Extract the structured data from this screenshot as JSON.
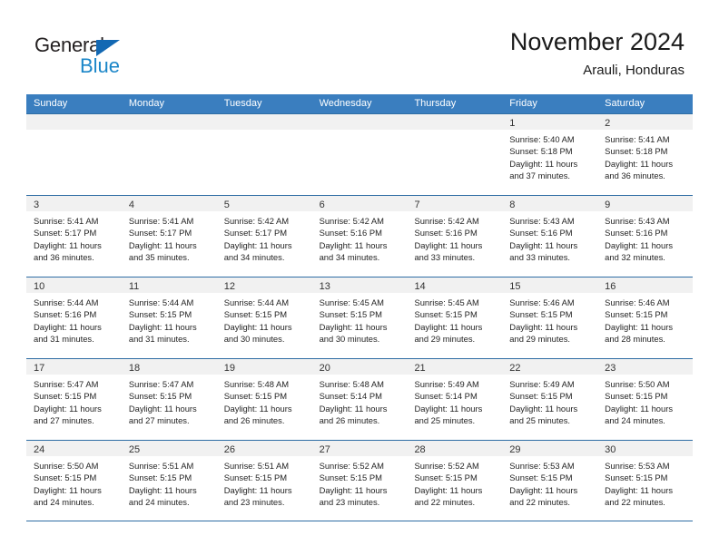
{
  "brand": {
    "name_part1": "General",
    "name_part2": "Blue",
    "triangle_color": "#1268b3",
    "blue_color": "#1b86c8"
  },
  "header": {
    "title": "November 2024",
    "subtitle": "Arauli, Honduras"
  },
  "theme": {
    "header_row_bg": "#3a7ebf",
    "row_border": "#2e6da4",
    "date_band_bg": "#f1f1f1",
    "text": "#242424"
  },
  "weekdays": [
    "Sunday",
    "Monday",
    "Tuesday",
    "Wednesday",
    "Thursday",
    "Friday",
    "Saturday"
  ],
  "labels": {
    "sunrise_prefix": "Sunrise:",
    "sunset_prefix": "Sunset:",
    "daylight_prefix": "Daylight:"
  },
  "weeks": [
    [
      {
        "day": "",
        "empty": true
      },
      {
        "day": "",
        "empty": true
      },
      {
        "day": "",
        "empty": true
      },
      {
        "day": "",
        "empty": true
      },
      {
        "day": "",
        "empty": true
      },
      {
        "day": "1",
        "line1": "Sunrise: 5:40 AM",
        "line2": "Sunset: 5:18 PM",
        "line3": "Daylight: 11 hours",
        "line4": "and 37 minutes."
      },
      {
        "day": "2",
        "line1": "Sunrise: 5:41 AM",
        "line2": "Sunset: 5:18 PM",
        "line3": "Daylight: 11 hours",
        "line4": "and 36 minutes."
      }
    ],
    [
      {
        "day": "3",
        "line1": "Sunrise: 5:41 AM",
        "line2": "Sunset: 5:17 PM",
        "line3": "Daylight: 11 hours",
        "line4": "and 36 minutes."
      },
      {
        "day": "4",
        "line1": "Sunrise: 5:41 AM",
        "line2": "Sunset: 5:17 PM",
        "line3": "Daylight: 11 hours",
        "line4": "and 35 minutes."
      },
      {
        "day": "5",
        "line1": "Sunrise: 5:42 AM",
        "line2": "Sunset: 5:17 PM",
        "line3": "Daylight: 11 hours",
        "line4": "and 34 minutes."
      },
      {
        "day": "6",
        "line1": "Sunrise: 5:42 AM",
        "line2": "Sunset: 5:16 PM",
        "line3": "Daylight: 11 hours",
        "line4": "and 34 minutes."
      },
      {
        "day": "7",
        "line1": "Sunrise: 5:42 AM",
        "line2": "Sunset: 5:16 PM",
        "line3": "Daylight: 11 hours",
        "line4": "and 33 minutes."
      },
      {
        "day": "8",
        "line1": "Sunrise: 5:43 AM",
        "line2": "Sunset: 5:16 PM",
        "line3": "Daylight: 11 hours",
        "line4": "and 33 minutes."
      },
      {
        "day": "9",
        "line1": "Sunrise: 5:43 AM",
        "line2": "Sunset: 5:16 PM",
        "line3": "Daylight: 11 hours",
        "line4": "and 32 minutes."
      }
    ],
    [
      {
        "day": "10",
        "line1": "Sunrise: 5:44 AM",
        "line2": "Sunset: 5:16 PM",
        "line3": "Daylight: 11 hours",
        "line4": "and 31 minutes."
      },
      {
        "day": "11",
        "line1": "Sunrise: 5:44 AM",
        "line2": "Sunset: 5:15 PM",
        "line3": "Daylight: 11 hours",
        "line4": "and 31 minutes."
      },
      {
        "day": "12",
        "line1": "Sunrise: 5:44 AM",
        "line2": "Sunset: 5:15 PM",
        "line3": "Daylight: 11 hours",
        "line4": "and 30 minutes."
      },
      {
        "day": "13",
        "line1": "Sunrise: 5:45 AM",
        "line2": "Sunset: 5:15 PM",
        "line3": "Daylight: 11 hours",
        "line4": "and 30 minutes."
      },
      {
        "day": "14",
        "line1": "Sunrise: 5:45 AM",
        "line2": "Sunset: 5:15 PM",
        "line3": "Daylight: 11 hours",
        "line4": "and 29 minutes."
      },
      {
        "day": "15",
        "line1": "Sunrise: 5:46 AM",
        "line2": "Sunset: 5:15 PM",
        "line3": "Daylight: 11 hours",
        "line4": "and 29 minutes."
      },
      {
        "day": "16",
        "line1": "Sunrise: 5:46 AM",
        "line2": "Sunset: 5:15 PM",
        "line3": "Daylight: 11 hours",
        "line4": "and 28 minutes."
      }
    ],
    [
      {
        "day": "17",
        "line1": "Sunrise: 5:47 AM",
        "line2": "Sunset: 5:15 PM",
        "line3": "Daylight: 11 hours",
        "line4": "and 27 minutes."
      },
      {
        "day": "18",
        "line1": "Sunrise: 5:47 AM",
        "line2": "Sunset: 5:15 PM",
        "line3": "Daylight: 11 hours",
        "line4": "and 27 minutes."
      },
      {
        "day": "19",
        "line1": "Sunrise: 5:48 AM",
        "line2": "Sunset: 5:15 PM",
        "line3": "Daylight: 11 hours",
        "line4": "and 26 minutes."
      },
      {
        "day": "20",
        "line1": "Sunrise: 5:48 AM",
        "line2": "Sunset: 5:14 PM",
        "line3": "Daylight: 11 hours",
        "line4": "and 26 minutes."
      },
      {
        "day": "21",
        "line1": "Sunrise: 5:49 AM",
        "line2": "Sunset: 5:14 PM",
        "line3": "Daylight: 11 hours",
        "line4": "and 25 minutes."
      },
      {
        "day": "22",
        "line1": "Sunrise: 5:49 AM",
        "line2": "Sunset: 5:15 PM",
        "line3": "Daylight: 11 hours",
        "line4": "and 25 minutes."
      },
      {
        "day": "23",
        "line1": "Sunrise: 5:50 AM",
        "line2": "Sunset: 5:15 PM",
        "line3": "Daylight: 11 hours",
        "line4": "and 24 minutes."
      }
    ],
    [
      {
        "day": "24",
        "line1": "Sunrise: 5:50 AM",
        "line2": "Sunset: 5:15 PM",
        "line3": "Daylight: 11 hours",
        "line4": "and 24 minutes."
      },
      {
        "day": "25",
        "line1": "Sunrise: 5:51 AM",
        "line2": "Sunset: 5:15 PM",
        "line3": "Daylight: 11 hours",
        "line4": "and 24 minutes."
      },
      {
        "day": "26",
        "line1": "Sunrise: 5:51 AM",
        "line2": "Sunset: 5:15 PM",
        "line3": "Daylight: 11 hours",
        "line4": "and 23 minutes."
      },
      {
        "day": "27",
        "line1": "Sunrise: 5:52 AM",
        "line2": "Sunset: 5:15 PM",
        "line3": "Daylight: 11 hours",
        "line4": "and 23 minutes."
      },
      {
        "day": "28",
        "line1": "Sunrise: 5:52 AM",
        "line2": "Sunset: 5:15 PM",
        "line3": "Daylight: 11 hours",
        "line4": "and 22 minutes."
      },
      {
        "day": "29",
        "line1": "Sunrise: 5:53 AM",
        "line2": "Sunset: 5:15 PM",
        "line3": "Daylight: 11 hours",
        "line4": "and 22 minutes."
      },
      {
        "day": "30",
        "line1": "Sunrise: 5:53 AM",
        "line2": "Sunset: 5:15 PM",
        "line3": "Daylight: 11 hours",
        "line4": "and 22 minutes."
      }
    ]
  ]
}
